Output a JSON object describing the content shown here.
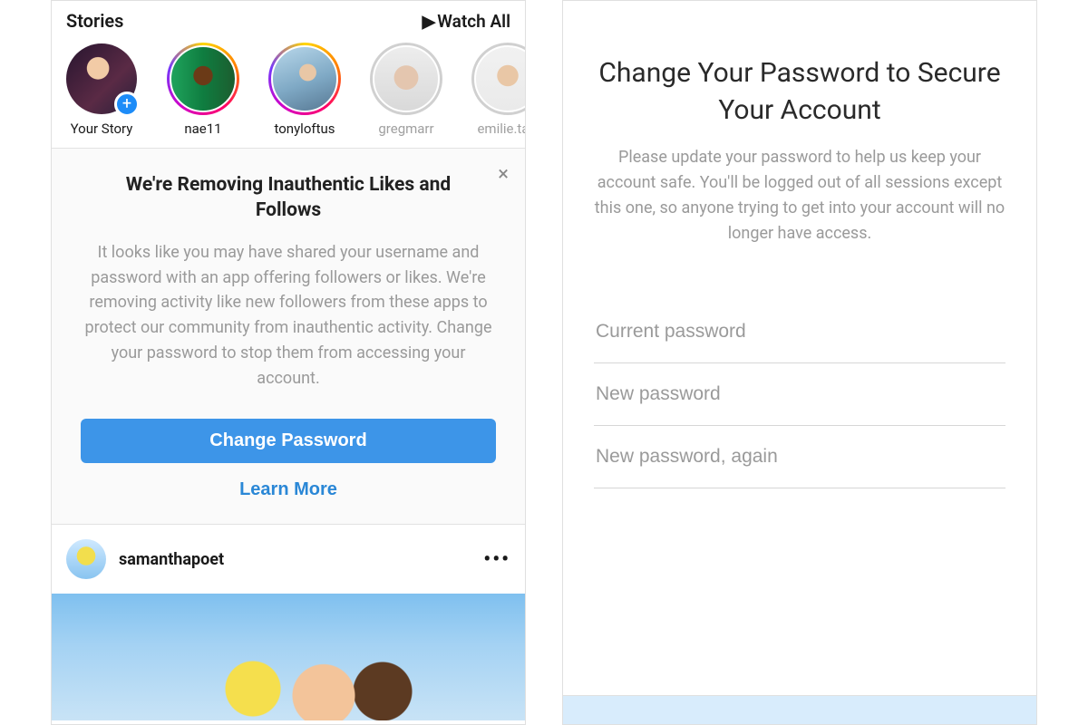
{
  "left": {
    "stories_label": "Stories",
    "watch_all_label": "Watch All",
    "stories": [
      {
        "name": "Your Story",
        "ring": "none",
        "muted": false,
        "has_add": true
      },
      {
        "name": "nae11",
        "ring": "gradient",
        "muted": false,
        "has_add": false
      },
      {
        "name": "tonyloftus",
        "ring": "gradient",
        "muted": false,
        "has_add": false
      },
      {
        "name": "gregmarr",
        "ring": "gray",
        "muted": true,
        "has_add": false
      },
      {
        "name": "emilie.ta…",
        "ring": "gray",
        "muted": true,
        "has_add": false
      }
    ],
    "notice": {
      "title": "We're Removing Inauthentic Likes and Follows",
      "body": "It looks like you may have shared your username and password with an app offering followers or likes. We're removing activity like new followers from these apps to protect our community from inauthentic activity. Change your password to stop them from accessing your account.",
      "primary_btn": "Change Password",
      "link_btn": "Learn More"
    },
    "post": {
      "username": "samanthapoet"
    }
  },
  "right": {
    "title": "Change Your Password to Secure Your Account",
    "subtitle": "Please update your password to help us keep your account safe. You'll be logged out of all sessions except this one, so anyone trying to get into your account will no longer have access.",
    "fields": {
      "current_placeholder": "Current password",
      "new_placeholder": "New password",
      "again_placeholder": "New password, again"
    }
  }
}
